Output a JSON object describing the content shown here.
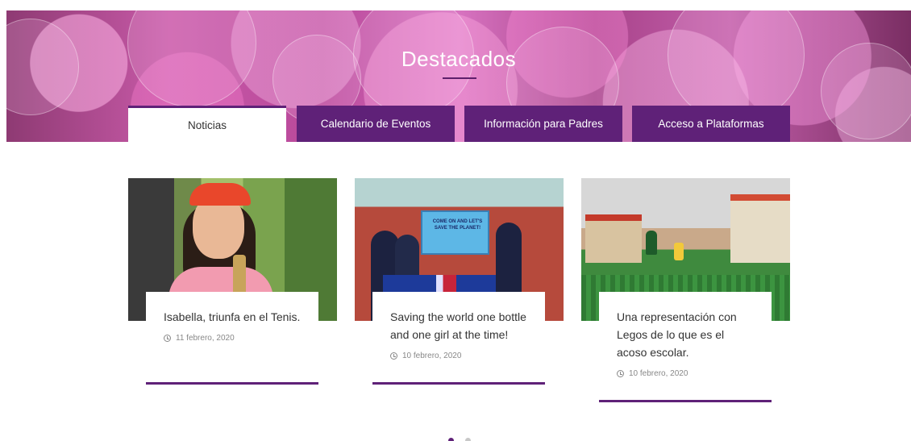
{
  "section": {
    "title": "Destacados"
  },
  "tabs": [
    {
      "label": "Noticias",
      "active": true
    },
    {
      "label": "Calendario de Eventos",
      "active": false
    },
    {
      "label": "Información para Padres",
      "active": false
    },
    {
      "label": "Acceso a Plataformas",
      "active": false
    }
  ],
  "cards": [
    {
      "title": "Isabella, triunfa en el Tenis.",
      "date": "11 febrero, 2020"
    },
    {
      "title": "Saving the world one bottle and one girl at the time!",
      "date": "10 febrero, 2020",
      "sign_text": "COME ON AND LET'S SAVE THE PLANET!"
    },
    {
      "title": "Una representación con Legos de lo que es el acoso escolar.",
      "date": "10 febrero, 2020"
    }
  ],
  "carousel": {
    "active_index": 0,
    "total": 2
  },
  "colors": {
    "accent": "#5f2178",
    "text": "#333333",
    "muted": "#888888"
  },
  "icons": {
    "date": "clock-icon"
  }
}
